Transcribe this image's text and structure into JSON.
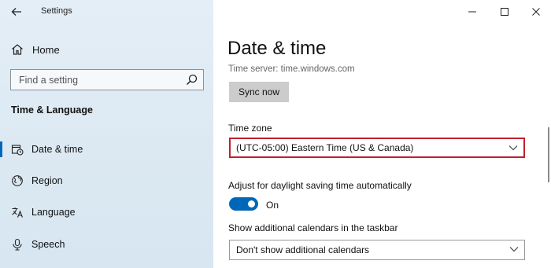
{
  "window": {
    "app_title": "Settings",
    "controls": [
      "minimize",
      "maximize",
      "close"
    ]
  },
  "sidebar": {
    "home_label": "Home",
    "search_placeholder": "Find a setting",
    "section_title": "Time & Language",
    "items": [
      {
        "label": "Date & time",
        "icon": "clock-calendar-icon",
        "active": true
      },
      {
        "label": "Region",
        "icon": "globe-icon",
        "active": false
      },
      {
        "label": "Language",
        "icon": "language-icon",
        "active": false
      },
      {
        "label": "Speech",
        "icon": "microphone-icon",
        "active": false
      }
    ]
  },
  "main": {
    "page_title": "Date & time",
    "time_server": "Time server: time.windows.com",
    "sync_button": "Sync now",
    "time_zone_label": "Time zone",
    "time_zone_value": "(UTC-05:00) Eastern Time (US & Canada)",
    "dst_label": "Adjust for daylight saving time automatically",
    "dst_toggle_state": "On",
    "dst_toggle_on": true,
    "calendars_label": "Show additional calendars in the taskbar",
    "calendars_value": "Don't show additional calendars"
  },
  "colors": {
    "accent": "#0067b8",
    "highlight_border": "#c21f2e",
    "sidebar_bg": "#dce9f3",
    "button_bg": "#cccccc"
  }
}
